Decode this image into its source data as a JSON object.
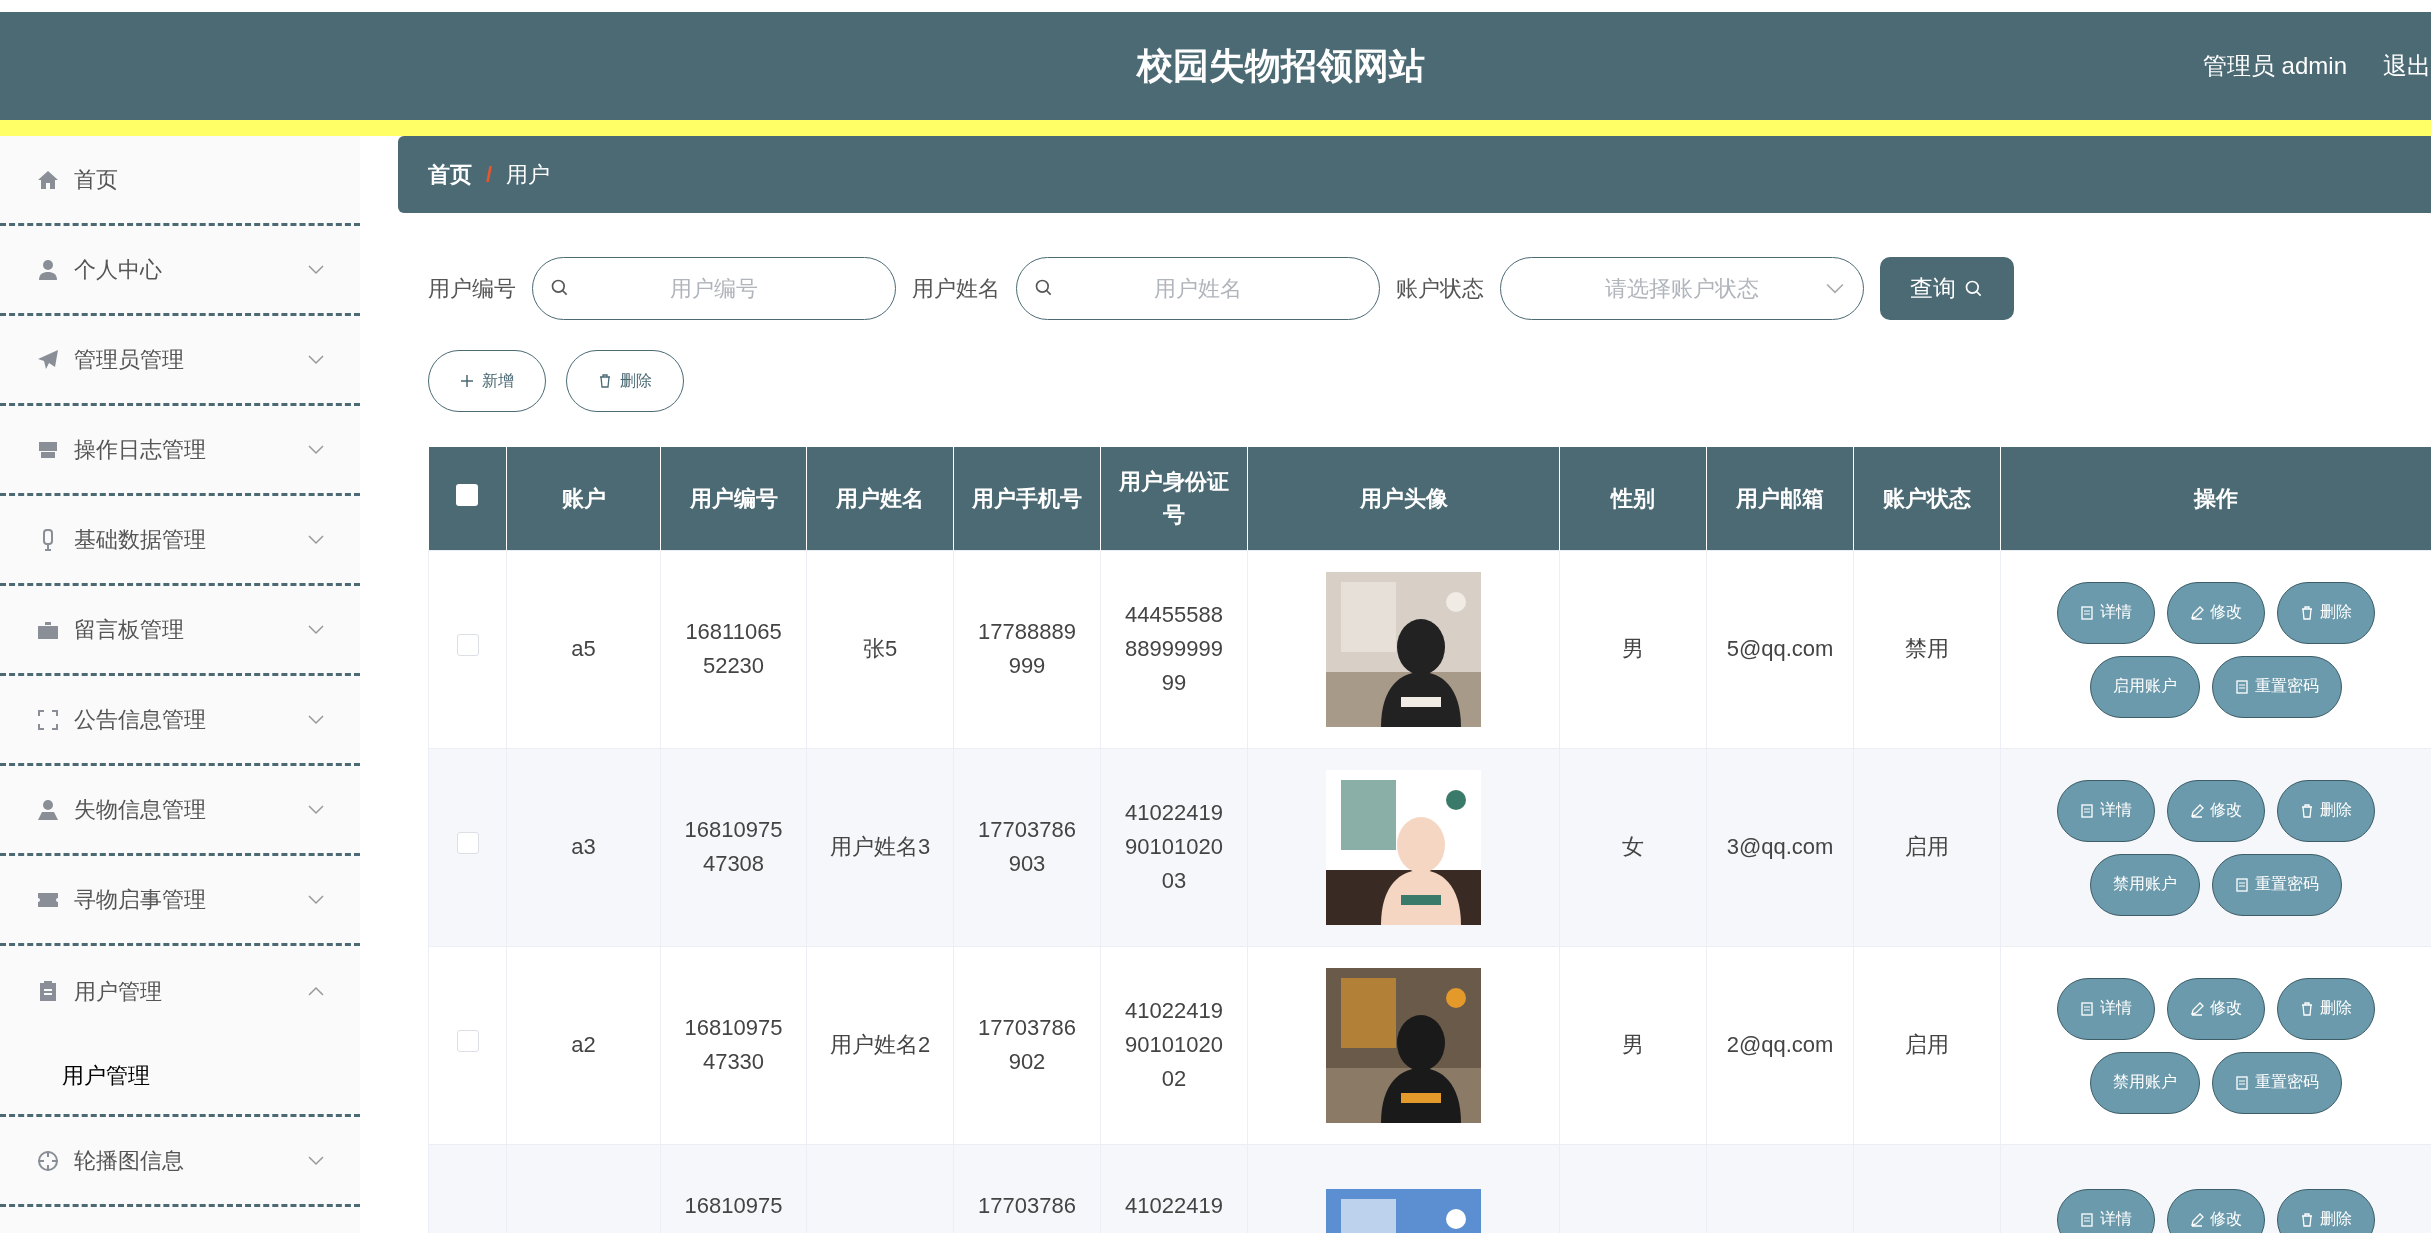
{
  "header": {
    "title": "校园失物招领网站",
    "user": "管理员 admin",
    "logout": "退出"
  },
  "sidebar": [
    {
      "label": "首页",
      "kind": "link"
    },
    {
      "label": "个人中心",
      "kind": "group",
      "expanded": false
    },
    {
      "label": "管理员管理",
      "kind": "group",
      "expanded": false
    },
    {
      "label": "操作日志管理",
      "kind": "group",
      "expanded": false
    },
    {
      "label": "基础数据管理",
      "kind": "group",
      "expanded": false
    },
    {
      "label": "留言板管理",
      "kind": "group",
      "expanded": false
    },
    {
      "label": "公告信息管理",
      "kind": "group",
      "expanded": false
    },
    {
      "label": "失物信息管理",
      "kind": "group",
      "expanded": false
    },
    {
      "label": "寻物启事管理",
      "kind": "group",
      "expanded": false
    },
    {
      "label": "用户管理",
      "kind": "group",
      "expanded": true,
      "children": [
        {
          "label": "用户管理",
          "selected": true
        }
      ]
    },
    {
      "label": "轮播图信息",
      "kind": "group",
      "expanded": false
    }
  ],
  "breadcrumb": {
    "items": [
      "首页",
      "用户"
    ],
    "separator": "/"
  },
  "filters": [
    {
      "label": "用户编号",
      "placeholder": "用户编号",
      "kind": "text"
    },
    {
      "label": "用户姓名",
      "placeholder": "用户姓名",
      "kind": "text"
    },
    {
      "label": "账户状态",
      "placeholder": "请选择账户状态",
      "kind": "select"
    }
  ],
  "search_button": "查询",
  "toolbar": [
    {
      "label": "新增",
      "kind": "add"
    },
    {
      "label": "删除",
      "kind": "delete"
    }
  ],
  "table": {
    "select_all": false,
    "columns": [
      "账户",
      "用户编号",
      "用户姓名",
      "用户手机号",
      "用户身份证号",
      "用户头像",
      "性别",
      "用户邮箱",
      "账户状态",
      "操作"
    ],
    "rows": [
      {
        "checked": false,
        "cells": [
          "a5",
          "1681106552230",
          "张5",
          "17788889999",
          "444555888899999999",
          {
            "kind": "picture"
          },
          "男",
          "5@qq.com",
          "禁用"
        ],
        "actions": [
          "详情",
          "修改",
          "删除",
          "启用账户",
          "重置密码"
        ]
      },
      {
        "checked": false,
        "cells": [
          "a3",
          "1681097547308",
          "用户姓名3",
          "17703786903",
          "410224199010102003",
          {
            "kind": "picture"
          },
          "女",
          "3@qq.com",
          "启用"
        ],
        "actions": [
          "详情",
          "修改",
          "删除",
          "禁用账户",
          "重置密码"
        ]
      },
      {
        "checked": false,
        "cells": [
          "a2",
          "1681097547330",
          "用户姓名2",
          "17703786902",
          "410224199010102002",
          {
            "kind": "picture"
          },
          "男",
          "2@qq.com",
          "启用"
        ],
        "actions": [
          "详情",
          "修改",
          "删除",
          "禁用账户",
          "重置密码"
        ]
      },
      {
        "cells": [
          "",
          "16810975",
          "",
          "17703786",
          "41022419",
          {
            "kind": "picture"
          },
          "",
          "",
          ""
        ],
        "actions": [
          "详情",
          "修改",
          "删除"
        ]
      }
    ]
  }
}
